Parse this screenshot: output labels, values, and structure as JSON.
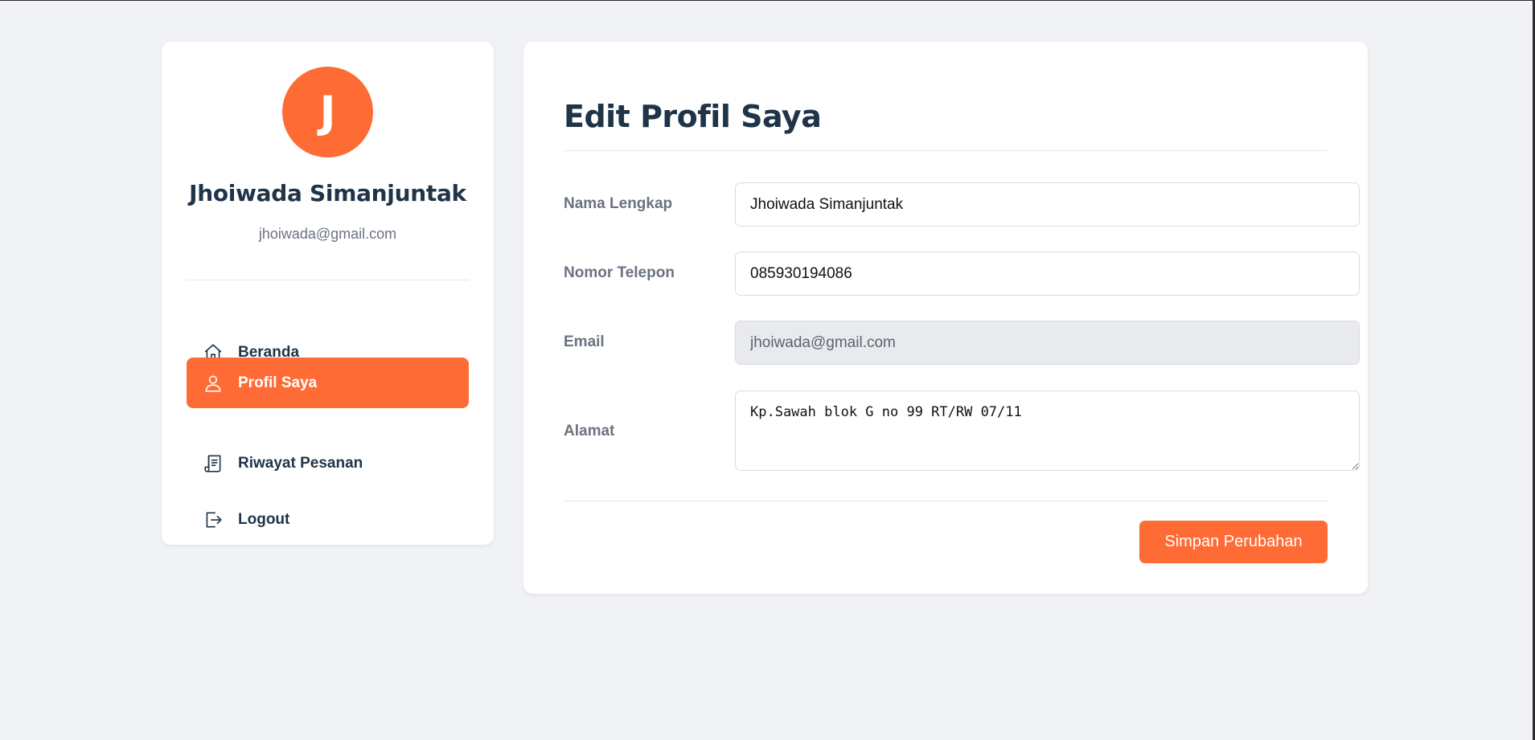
{
  "profile": {
    "avatar_initial": "J",
    "name": "Jhoiwada Simanjuntak",
    "email": "jhoiwada@gmail.com"
  },
  "sidebar": {
    "items": [
      {
        "label": "Beranda",
        "icon": "home-icon",
        "active": false
      },
      {
        "label": "Profil Saya",
        "icon": "user-icon",
        "active": true
      },
      {
        "label": "Riwayat Pesanan",
        "icon": "receipt-icon",
        "active": false
      },
      {
        "label": "Logout",
        "icon": "logout-icon",
        "active": false
      }
    ]
  },
  "form": {
    "title": "Edit Profil Saya",
    "fields": {
      "full_name": {
        "label": "Nama Lengkap",
        "value": "Jhoiwada Simanjuntak"
      },
      "phone": {
        "label": "Nomor Telepon",
        "value": "085930194086"
      },
      "email": {
        "label": "Email",
        "value": "jhoiwada@gmail.com",
        "disabled": true
      },
      "address": {
        "label": "Alamat",
        "value": "Kp.Sawah blok G no 99 RT/RW 07/11"
      }
    },
    "save_label": "Simpan Perubahan"
  },
  "colors": {
    "accent": "#ff6b35",
    "text_dark": "#1f3448",
    "text_muted": "#6b7280",
    "background": "#f0f2f5"
  }
}
